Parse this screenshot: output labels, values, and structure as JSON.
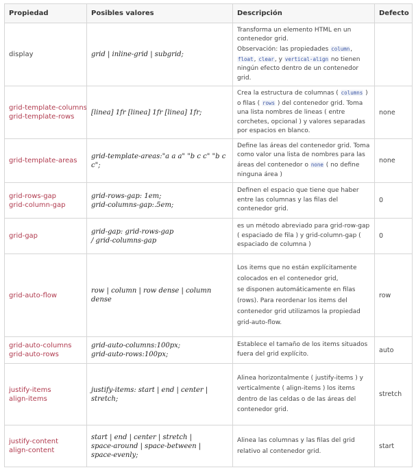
{
  "headers": {
    "property": "Propiedad",
    "values": "Posibles valores",
    "description": "Descripción",
    "default": "Defecto"
  },
  "rows": [
    {
      "property": [
        "display"
      ],
      "values": [
        "grid | inline-grid | subgrid;"
      ],
      "description": [
        {
          "t": "Transforma un elemento HTML en un contenedor grid."
        },
        {
          "br": true
        },
        {
          "t": "Observación: las propiedades "
        },
        {
          "code": "column"
        },
        {
          "t": ", "
        },
        {
          "code": "float"
        },
        {
          "t": ", "
        },
        {
          "code": "clear"
        },
        {
          "t": ", y "
        },
        {
          "code": "vertical-align"
        },
        {
          "t": " no tienen ningún efecto dentro de un contenedor grid."
        }
      ],
      "default": ""
    },
    {
      "property": [
        "grid-template-columns",
        "grid-template-rows"
      ],
      "values": [
        "[linea] 1fr [linea] 1fr [linea] 1fr;"
      ],
      "description": [
        {
          "t": "Crea la estructura de columnas ( "
        },
        {
          "code": "columns"
        },
        {
          "t": " ) o filas ( "
        },
        {
          "code": "rows"
        },
        {
          "t": " ) del contenedor grid. Toma una lista nombres de lineas ( entre corchetes, opcional ) y valores separadas por espacios en blanco."
        }
      ],
      "default": "none"
    },
    {
      "property": [
        "grid-template-areas"
      ],
      "values": [
        "grid-template-areas:\"a a a\" \"b c c\" \"b c c\";"
      ],
      "description": [
        {
          "t": "Define las áreas del contenedor grid. Toma como valor una lista de nombres para las áreas del contenedor o "
        },
        {
          "code": "none"
        },
        {
          "t": " ( no define ninguna área )"
        }
      ],
      "default": "none"
    },
    {
      "property": [
        "grid-rows-gap",
        "grid-column-gap"
      ],
      "values": [
        "grid-rows-gap: 1em;",
        "grid-columns-gap:.5em;"
      ],
      "description": [
        {
          "t": "Definen el espacio que tiene que haber entre las columnas y las filas del contenedor grid."
        }
      ],
      "default": "0"
    },
    {
      "property": [
        "grid-gap"
      ],
      "values": [
        "grid-gap: grid-rows-gap",
        "/ grid-columns-gap"
      ],
      "description": [
        {
          "t": "es un método abreviado para grid-row-gap ( espaciado de fila ) y grid-column-gap ( espaciado de columna )"
        }
      ],
      "default": "0"
    },
    {
      "property": [
        "grid-auto-flow"
      ],
      "values": [
        "row | column | row dense | column dense"
      ],
      "description": [
        {
          "t": "Los items que no están explícitamente colocados en el contenedor grid,"
        },
        {
          "br": true
        },
        {
          "t": "se disponen automáticamente en filas (rows). Para reordenar los items del contenedor grid utilizamos la propiedad grid-auto-flow."
        }
      ],
      "default": "row",
      "line_height": 16
    },
    {
      "property": [
        "grid-auto-columns",
        "grid-auto-rows"
      ],
      "values": [
        "grid-auto-columns:100px;",
        "grid-auto-rows:100px;"
      ],
      "description": [
        {
          "t": "Establece el tamaño de los items situados fuera del grid explícito."
        }
      ],
      "default": "auto"
    },
    {
      "property": [
        "justify-items",
        "align-items"
      ],
      "values": [
        "justify-items: start | end | center | stretch;"
      ],
      "description": [
        {
          "t": "Alinea horizontalmente ( justify-items ) y verticalmente ( align-items ) los items dentro de las celdas o de las áreas del contenedor grid."
        }
      ],
      "default": "stretch",
      "line_height": 15.5
    },
    {
      "property": [
        "justify-content",
        "align-content"
      ],
      "values": [
        "start | end | center | stretch |",
        "space-around | space-between |",
        "space-evenly;"
      ],
      "description": [
        {
          "t": "Alinea las columnas y las filas del grid relativo al contenedor grid."
        }
      ],
      "default": "start",
      "line_height": 16
    }
  ]
}
